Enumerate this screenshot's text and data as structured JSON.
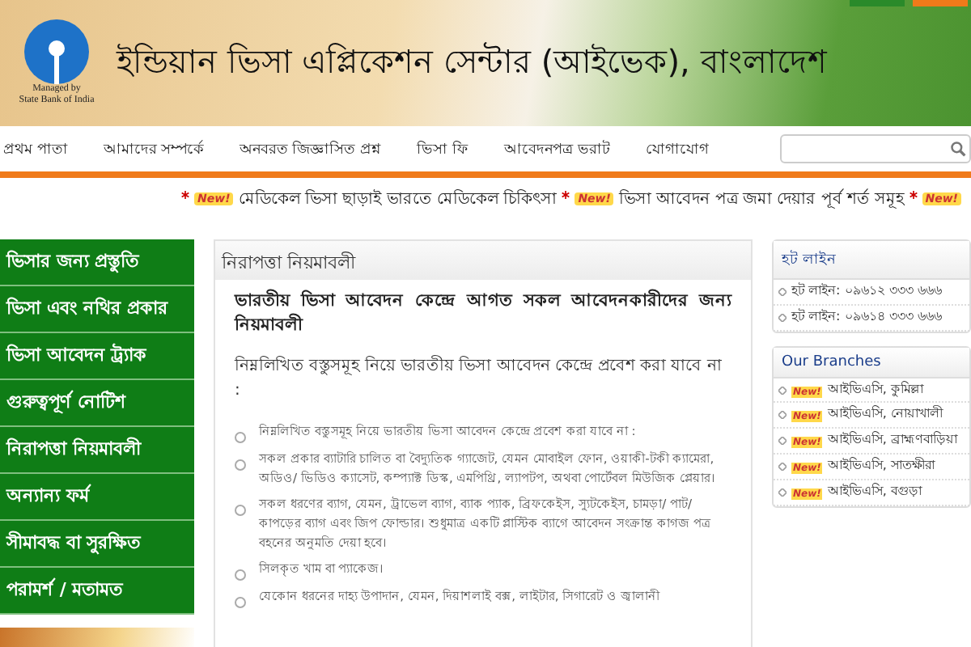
{
  "header": {
    "logo_caption": "Managed by\nState Bank of India",
    "title": "ইন্ডিয়ান ভিসা এপ্লিকেশন সেন্টার (আইভেক), বাংলাদেশ"
  },
  "nav": {
    "items": [
      "প্রথম পাতা",
      "আমাদের সম্পর্কে",
      "অনবরত জিজ্ঞাসিত প্রশ্ন",
      "ভিসা ফি",
      "আবেদনপত্র ভরাট",
      "যোগাযোগ"
    ]
  },
  "ticker": [
    {
      "badge": "New!",
      "text": "মেডিকেল ভিসা ছাড়াই ভারতে মেডিকেল চিকিৎসা"
    },
    {
      "badge": "New!",
      "text": "ভিসা আবেদন পত্র জমা দেয়ার পূর্ব শর্ত সমূহ"
    },
    {
      "badge": "New!"
    }
  ],
  "sidebar": {
    "items": [
      {
        "label": "ভিসার জন্য প্রস্তুতি",
        "selected": false
      },
      {
        "label": "ভিসা এবং নথির প্রকার",
        "selected": false
      },
      {
        "label": "ভিসা আবেদন ট্র্যাক",
        "selected": false
      },
      {
        "label": "গুরুত্বপূর্ণ নোটিশ",
        "selected": false
      },
      {
        "label": "নিরাপত্তা নিয়মাবলী",
        "selected": false
      },
      {
        "label": "অন্যান্য ফর্ম",
        "selected": false
      },
      {
        "label": "সীমাবদ্ধ বা সুরক্ষিত",
        "selected": false
      },
      {
        "label": "পরামর্শ / মতামত",
        "selected": false
      }
    ]
  },
  "content": {
    "title": "নিরাপত্তা নিয়মাবলী",
    "heading": "ভারতীয় ভিসা আবেদন কেন্দ্রে আগত সকল আবেদনকারীদের জন্য নিয়মাবলী",
    "intro": "নিম্নলিখিত বস্তুসমূহ নিয়ে ভারতীয় ভিসা আবেদন কেন্দ্রে প্রবেশ করা যাবে না :",
    "rules": [
      "নিম্নলিখিত বস্তুসমূহ নিয়ে ভারতীয় ভিসা আবেদন কেন্দ্রে প্রবেশ করা যাবে না :",
      "সকল প্রকার ব্যাটারি চালিত বা বৈদ্যুতিক গ্যাজেট, যেমন মোবাইল ফোন, ওয়াকী-টকী ক্যামেরা, অডিও/ ভিডিও ক্যাসেট, কম্প্যাক্ট ডিস্ক, এমপিথ্রি, ল্যাপটপ, অথবা পোর্টেবল মিউজিক প্লেয়ার।",
      "সকল ধরণের ব্যাগ, যেমন, ট্রাভেল ব্যাগ, ব্যাক প্যাক, ব্রিফকেইস, স্যুটকেইস, চামড়া/ পাট/ কাপড়ের ব্যাগ এবং জিপ ফোল্ডার। শুধুমাত্র একটি প্লাস্টিক ব্যাগে আবেদন সংক্রান্ত কাগজ পত্র বহনের অনুমতি দেয়া হবে।",
      "সিলকৃত খাম বা প্যাকেজ।",
      "যেকোন ধরনের দাহ্য উপাদান, যেমন, দিয়াশলাই বক্স, লাইটার, সিগারেট ও জ্বালানী"
    ]
  },
  "hotline": {
    "title": "হট লাইন",
    "items": [
      "হট লাইন: ০৯৬১২ ৩৩৩ ৬৬৬",
      "হট লাইন: ০৯৬১৪ ৩৩৩ ৬৬৬"
    ]
  },
  "branches": {
    "title": "Our Branches",
    "items": [
      {
        "badge": "New!",
        "name": "আইভিএসি, কুমিল্লা"
      },
      {
        "badge": "New!",
        "name": "আইভিএসি, নোয়াখালী"
      },
      {
        "badge": "New!",
        "name": "আইভিএসি, ব্রাহ্মণবাড়িয়া"
      },
      {
        "badge": "New!",
        "name": "আইভিএসি, সাতক্ষীরা"
      },
      {
        "badge": "New!",
        "name": "আইভিএসি, বগুড়া"
      }
    ]
  }
}
